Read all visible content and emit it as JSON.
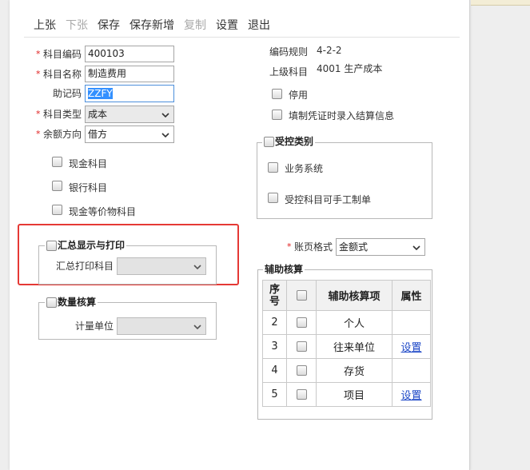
{
  "toolbar": {
    "items": [
      {
        "label": "上张",
        "enabled": true
      },
      {
        "label": "下张",
        "enabled": false
      },
      {
        "label": "保存",
        "enabled": true
      },
      {
        "label": "保存新增",
        "enabled": true
      },
      {
        "label": "复制",
        "enabled": false
      },
      {
        "label": "设置",
        "enabled": true
      },
      {
        "label": "退出",
        "enabled": true
      }
    ]
  },
  "form": {
    "required_mark": "*",
    "code": {
      "label": "科目编码",
      "value": "400103"
    },
    "name": {
      "label": "科目名称",
      "value": "制造费用"
    },
    "mnemonic": {
      "label": "助记码",
      "value": "ZZFY"
    },
    "type": {
      "label": "科目类型",
      "value": "成本"
    },
    "balance_direction": {
      "label": "余额方向",
      "value": "借方"
    },
    "cash_account": {
      "label": "现金科目",
      "checked": false
    },
    "bank_account": {
      "label": "银行科目",
      "checked": false
    },
    "cash_equivalent": {
      "label": "现金等价物科目",
      "checked": false
    }
  },
  "info": {
    "code_rule": {
      "label": "编码规则",
      "value": "4-2-2"
    },
    "parent_account": {
      "label": "上级科目",
      "value": "4001 生产成本"
    },
    "inactive": {
      "label": "停用",
      "checked": false
    },
    "settlement_info": {
      "label": "填制凭证时录入结算信息",
      "checked": false
    }
  },
  "controlled": {
    "legend": "受控类别",
    "checked": false,
    "business_system": {
      "label": "业务系统",
      "checked": false
    },
    "manual_voucher": {
      "label": "受控科目可手工制单",
      "checked": false
    }
  },
  "summary_print": {
    "legend": "汇总显示与打印",
    "checked": false,
    "print_account_label": "汇总打印科目"
  },
  "quantity": {
    "legend": "数量核算",
    "checked": false,
    "unit_label": "计量单位"
  },
  "ledger_format": {
    "label": "账页格式",
    "value": "金额式"
  },
  "auxiliary": {
    "legend": "辅助核算",
    "columns": {
      "no": "序号",
      "item": "辅助核算项",
      "attr": "属性"
    },
    "all_checked": false,
    "rows": [
      {
        "no": "2",
        "item": "个人",
        "checked": false
      },
      {
        "no": "3",
        "item": "往来单位",
        "attr": "设置",
        "checked": false
      },
      {
        "no": "4",
        "item": "存货",
        "checked": false
      },
      {
        "no": "5",
        "item": "项目",
        "attr": "设置",
        "checked": false
      }
    ]
  },
  "colors": {
    "required": "#e02020",
    "selection": "#3390ff",
    "link": "#1c47c7",
    "callout": "#e53935",
    "disabled_text": "#a9a9a9"
  },
  "icons": {
    "select_arrow": "chevron-down-icon"
  }
}
